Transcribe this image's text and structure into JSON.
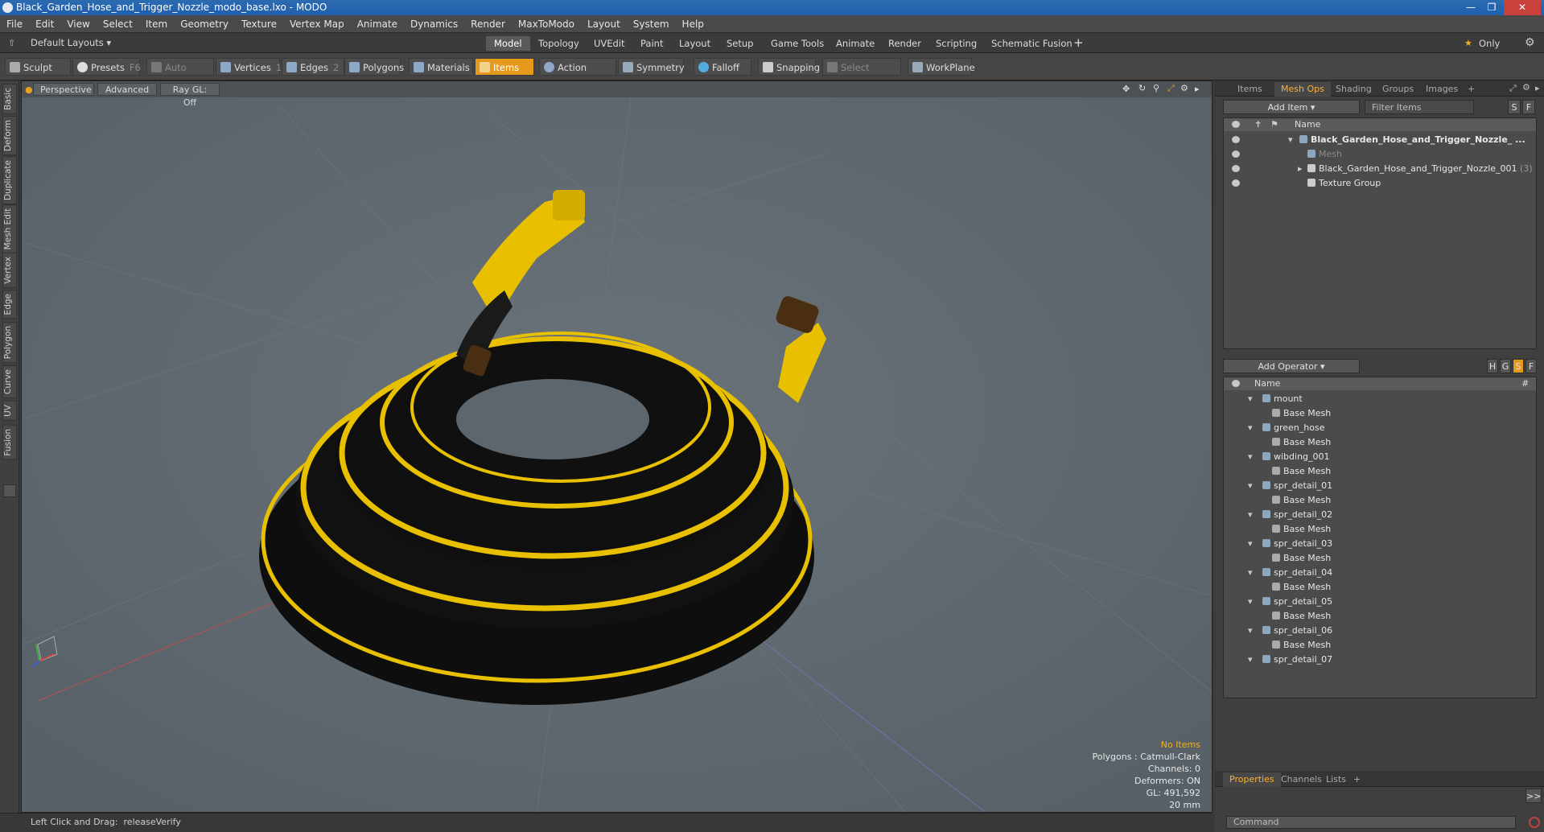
{
  "window": {
    "title": "Black_Garden_Hose_and_Trigger_Nozzle_modo_base.lxo - MODO"
  },
  "menu": [
    "File",
    "Edit",
    "View",
    "Select",
    "Item",
    "Geometry",
    "Texture",
    "Vertex Map",
    "Animate",
    "Dynamics",
    "Render",
    "MaxToModo",
    "Layout",
    "System",
    "Help"
  ],
  "layouts": {
    "current": "Default Layouts",
    "tabs": [
      "Model",
      "Topology",
      "UVEdit",
      "Paint",
      "Layout",
      "Setup",
      "Game Tools",
      "Animate",
      "Render",
      "Scripting",
      "Schematic Fusion"
    ],
    "active": "Model",
    "only_label": "Only"
  },
  "toolbar": {
    "sculpt": "Sculpt",
    "presets": "Presets",
    "presets_key": "F6",
    "auto_select": "Auto Select",
    "vertices": "Vertices",
    "vertices_count": "1",
    "edges": "Edges",
    "edges_count": "2",
    "polygons": "Polygons",
    "materials": "Materials",
    "items": "Items",
    "action_center": "Action Center",
    "symmetry": "Symmetry",
    "falloff": "Falloff",
    "snapping": "Snapping",
    "select_through": "Select Through",
    "workplane": "WorkPlane"
  },
  "side_tabs": [
    "Basic",
    "Deform",
    "Duplicate",
    "Mesh Edit",
    "Vertex",
    "Edge",
    "Polygon",
    "Curve",
    "UV",
    "Fusion"
  ],
  "viewport": {
    "view": "Perspective",
    "shading": "Advanced",
    "raygl": "Ray GL: Off",
    "info": {
      "items": "No Items",
      "polygons": "Polygons : Catmull-Clark",
      "channels": "Channels: 0",
      "deformers": "Deformers: ON",
      "gl": "GL: 491,592",
      "scale": "20 mm"
    },
    "colors": {
      "background": "#5d666c",
      "hose_black": "#0e0e0e",
      "stripe_yellow": "#e8c000"
    }
  },
  "status": {
    "hint_label": "Left Click and Drag:",
    "hint_value": "releaseVerify"
  },
  "items_panel": {
    "tabs": [
      "Items",
      "Mesh Ops",
      "Shading",
      "Groups",
      "Images"
    ],
    "active": "Mesh Ops",
    "add_item": "Add Item",
    "filter": "Filter Items",
    "name_header": "Name",
    "s_label": "S",
    "f_label": "F",
    "tree": [
      {
        "label": "Black_Garden_Hose_and_Trigger_Nozzle_ ...",
        "bold": true,
        "indent": 0
      },
      {
        "label": "Mesh",
        "dim": true,
        "indent": 1
      },
      {
        "label": "Black_Garden_Hose_and_Trigger_Nozzle_001",
        "suffix": "(3)",
        "indent": 1
      },
      {
        "label": "Texture Group",
        "indent": 1
      }
    ]
  },
  "meshops_panel": {
    "add_operator": "Add Operator",
    "name_header": "Name",
    "hash_header": "#",
    "h_label": "H",
    "g_label": "G",
    "s_label": "S",
    "f_label": "F",
    "ops": [
      {
        "name": "mount",
        "child": "Base Mesh"
      },
      {
        "name": "green_hose",
        "child": "Base Mesh"
      },
      {
        "name": "wibding_001",
        "child": "Base Mesh"
      },
      {
        "name": "spr_detail_01",
        "child": "Base Mesh"
      },
      {
        "name": "spr_detail_02",
        "child": "Base Mesh"
      },
      {
        "name": "spr_detail_03",
        "child": "Base Mesh"
      },
      {
        "name": "spr_detail_04",
        "child": "Base Mesh"
      },
      {
        "name": "spr_detail_05",
        "child": "Base Mesh"
      },
      {
        "name": "spr_detail_06",
        "child": "Base Mesh"
      },
      {
        "name": "spr_detail_07",
        "child": ""
      }
    ]
  },
  "props_panel": {
    "tabs": [
      "Properties",
      "Channels",
      "Lists"
    ],
    "active": "Properties",
    "expand": ">>"
  },
  "command": {
    "placeholder": "Command"
  }
}
